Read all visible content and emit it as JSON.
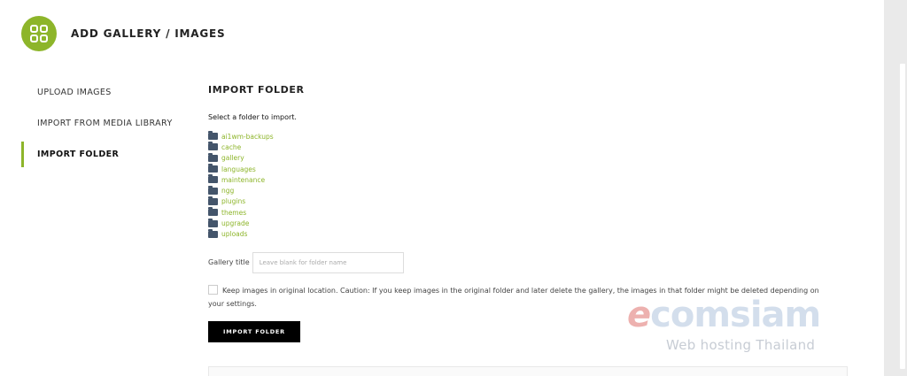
{
  "header": {
    "title": "ADD GALLERY / IMAGES",
    "icon": "grid-icon",
    "accent_color": "#8db52a"
  },
  "nav": {
    "items": [
      {
        "label": "UPLOAD IMAGES"
      },
      {
        "label": "IMPORT FROM MEDIA LIBRARY"
      },
      {
        "label": "IMPORT FOLDER"
      }
    ],
    "active": "IMPORT FOLDER"
  },
  "main": {
    "section_title": "IMPORT FOLDER",
    "intro": "Select a folder to import.",
    "folders": [
      "ai1wm-backups",
      "cache",
      "gallery",
      "languages",
      "maintenance",
      "ngg",
      "plugins",
      "themes",
      "upgrade",
      "uploads"
    ],
    "gallery_title_label": "Gallery title",
    "gallery_title_placeholder": "Leave blank for folder name",
    "gallery_title_value": "",
    "keep_images_text": "Keep images in original location. Caution: If you keep images in the original folder and later delete the gallery, the images in that folder might be deleted depending on your settings.",
    "keep_images_checked": false,
    "import_button_label": "IMPORT FOLDER"
  },
  "watermark": {
    "brand_e": "e",
    "brand_rest": "comsiam",
    "subtitle": "Web hosting Thailand"
  }
}
